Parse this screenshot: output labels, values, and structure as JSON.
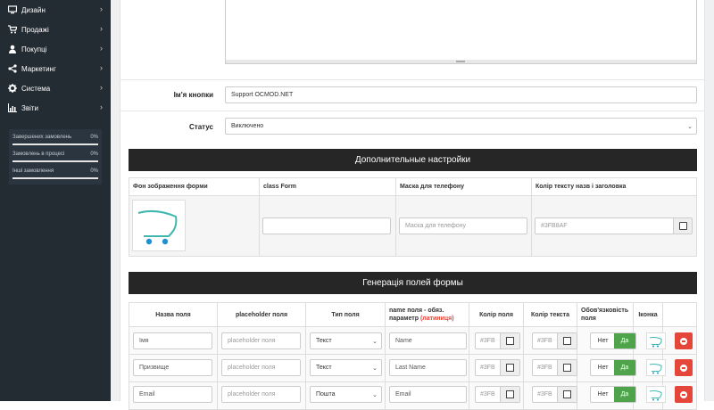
{
  "sidebar": {
    "items": [
      {
        "icon": "monitor-icon",
        "label": "Дизайн"
      },
      {
        "icon": "cart-icon",
        "label": "Продажі"
      },
      {
        "icon": "user-icon",
        "label": "Покупці"
      },
      {
        "icon": "share-icon",
        "label": "Маркетинг"
      },
      {
        "icon": "gear-icon",
        "label": "Система"
      },
      {
        "icon": "bar-chart-icon",
        "label": "Звіти"
      }
    ],
    "stats": [
      {
        "label": "Завершених замовлень",
        "percent": "0%",
        "value": 0.0
      },
      {
        "label": "Замовлень в процесі",
        "percent": "0%",
        "value": 0.0
      },
      {
        "label": "Інші замовлення",
        "percent": "0%",
        "value": 0.0
      }
    ]
  },
  "form": {
    "button_name_label": "Ім'я кнопки",
    "button_name_value": "Support OCMOD.NET",
    "status_label": "Статус",
    "status_value": "Виключено"
  },
  "extra": {
    "title": "Дополнительные настройки",
    "headers": [
      "Фон зображення форми",
      "class Form",
      "Маска для телефону",
      "Колір тексту назв і заголовка"
    ],
    "class_form_value": "",
    "phone_mask_placeholder": "Маска для телефону",
    "title_color_value": "#3FB8AF"
  },
  "fields": {
    "title": "Генерація полей формы",
    "headers": {
      "name": "Назва поля",
      "placeholder": "placeholder поля",
      "type": "Тип поля",
      "param": "name поля - обяз. параметр",
      "param_note": "(латиниця)",
      "field_color": "Колір поля",
      "text_color": "Колір текста",
      "required": "Обов'язковість поля",
      "icon": "Іконка"
    },
    "rows": [
      {
        "name": "Імя",
        "placeholder": "placeholder поля",
        "type": "Текст",
        "param": "Name",
        "field_color": "#3FB",
        "text_color": "#3FB",
        "no": "Нет",
        "yes": "Да"
      },
      {
        "name": "Призвище",
        "placeholder": "placeholder поля",
        "type": "Текст",
        "param": "Last Name",
        "field_color": "#3FB",
        "text_color": "#3FB",
        "no": "Нет",
        "yes": "Да"
      },
      {
        "name": "Email",
        "placeholder": "placeholder поля",
        "type": "Пошта",
        "param": "Email",
        "field_color": "#3FB",
        "text_color": "#3FB",
        "no": "Нет",
        "yes": "Да"
      }
    ]
  },
  "colors": {
    "accent": "#3fb8af",
    "dark": "#262626",
    "sidebar": "#232b33",
    "green": "#4ea34b",
    "red": "#e4473a"
  }
}
